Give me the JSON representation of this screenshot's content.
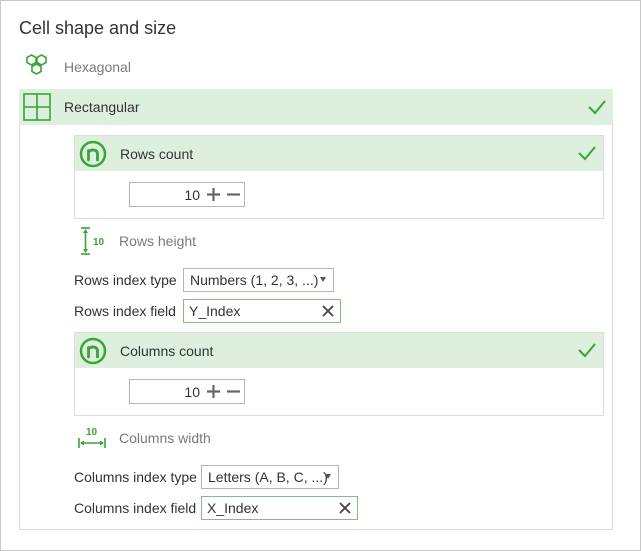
{
  "title": "Cell shape and size",
  "shapes": [
    {
      "label": "Hexagonal",
      "icon": "hexagon-grid-icon",
      "selected": false
    },
    {
      "label": "Rectangular",
      "icon": "rectangle-grid-icon",
      "selected": true
    }
  ],
  "rows": {
    "count_label": "Rows count",
    "count_value": "10",
    "height_label": "Rows height",
    "height_icon_text": "10",
    "index_type_label": "Rows index type",
    "index_type_value": "Numbers (1, 2, 3, ...)",
    "index_field_label": "Rows index field",
    "index_field_value": "Y_Index"
  },
  "columns": {
    "count_label": "Columns count",
    "count_value": "10",
    "width_label": "Columns width",
    "width_icon_text": "10",
    "index_type_label": "Columns index type",
    "index_type_value": "Letters (A, B, C, ...)",
    "index_field_label": "Columns index field",
    "index_field_value": "X_Index"
  },
  "colors": {
    "accent": "#3aa33a",
    "selected_bg": "#ddf0dd",
    "border": "#dcdcdc"
  }
}
